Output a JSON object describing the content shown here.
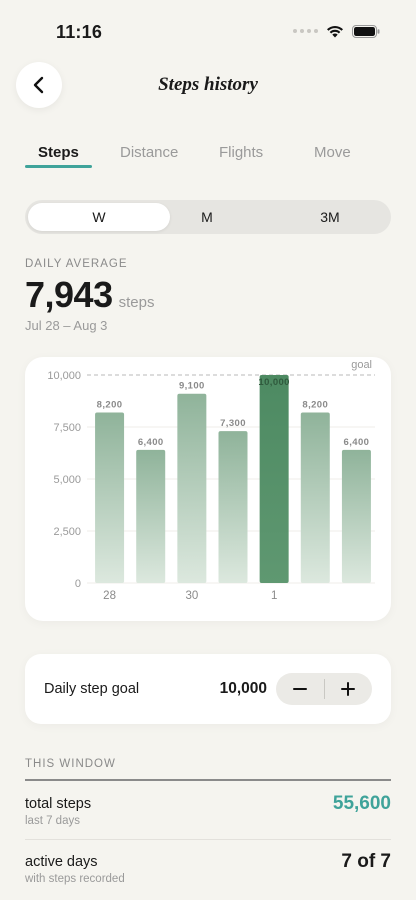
{
  "status_bar": {
    "time": "11:16"
  },
  "header": {
    "title": "Steps history",
    "back_icon": "chevron-left-icon"
  },
  "tabs": [
    {
      "label": "Steps",
      "active": true
    },
    {
      "label": "Distance",
      "active": false
    },
    {
      "label": "Flights",
      "active": false
    },
    {
      "label": "Move",
      "active": false
    }
  ],
  "range_selector": {
    "options": [
      "W",
      "M",
      "3M"
    ],
    "selected": "W"
  },
  "summary": {
    "label": "DAILY AVERAGE",
    "value": "7,943",
    "unit": "steps",
    "date_range": "Jul 28 – Aug 3"
  },
  "chart_data": {
    "type": "bar",
    "categories": [
      "Jul 28",
      "Jul 29",
      "Jul 30",
      "Jul 31",
      "Aug 1",
      "Aug 2",
      "Aug 3"
    ],
    "values": [
      8200,
      6400,
      9100,
      7300,
      10000,
      8200,
      6400
    ],
    "value_labels": [
      "8,200",
      "6,400",
      "9,100",
      "7,300",
      "10,000",
      "8,200",
      "6,400"
    ],
    "x_tick_labels": [
      "28",
      "",
      "30",
      "",
      "1",
      "",
      ""
    ],
    "y_ticks": [
      0,
      2500,
      5000,
      7500,
      10000
    ],
    "y_tick_labels": [
      "0",
      "2,500",
      "5,000",
      "7,500",
      "10,000"
    ],
    "ylim": [
      0,
      10000
    ],
    "goal": 10000,
    "goal_label": "goal",
    "highlight_index": 4,
    "colors": {
      "bar": "#8fb39a",
      "bar_highlight": "#4d8a62",
      "goal_line": "#c8c8c8"
    }
  },
  "goal_setting": {
    "label": "Daily step goal",
    "value": "10,000",
    "decrement_icon": "minus-icon",
    "increment_icon": "plus-icon"
  },
  "window_stats": {
    "label": "THIS WINDOW",
    "rows": [
      {
        "title": "total steps",
        "subtitle": "last 7 days",
        "value": "55,600",
        "accent": true
      },
      {
        "title": "active days",
        "subtitle": "with steps recorded",
        "value": "7 of 7",
        "accent": false
      }
    ]
  },
  "colors": {
    "accent": "#3fa39a",
    "background": "#f5f4ef"
  }
}
